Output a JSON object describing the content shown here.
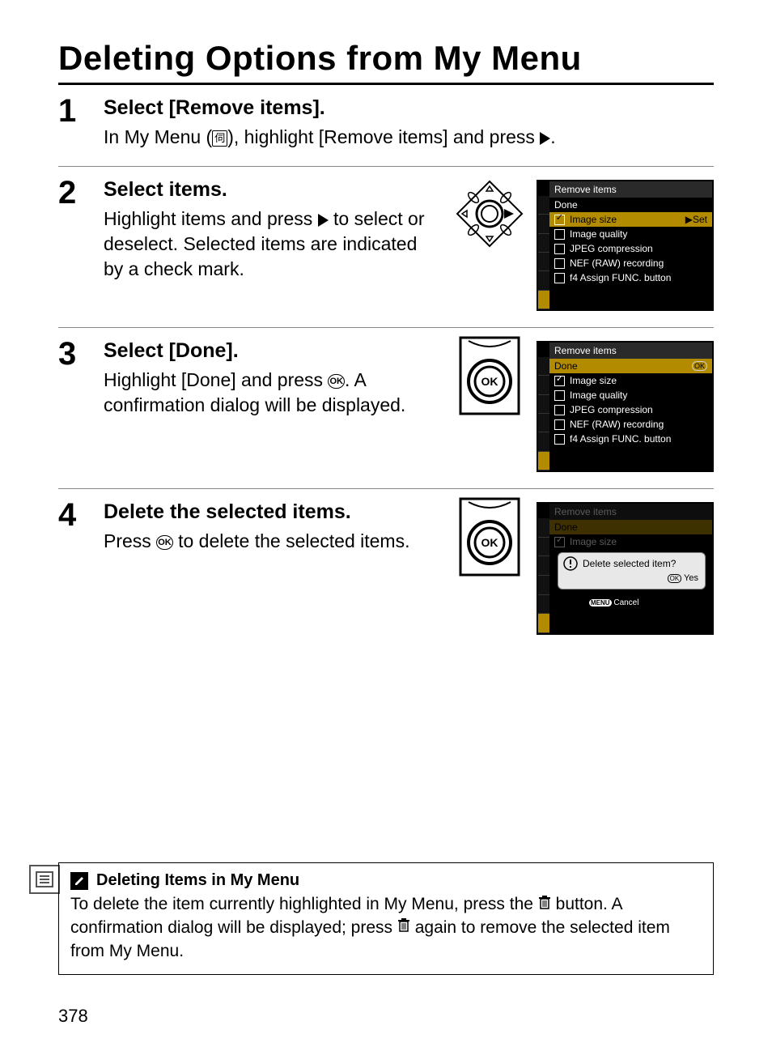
{
  "page_number": "378",
  "section_title": "Deleting Options from My Menu",
  "steps": [
    {
      "num": "1",
      "head": "Select [Remove items].",
      "text_pre": "In My Menu (",
      "text_post": "), highlight [Remove items] and press ",
      "text_end": "."
    },
    {
      "num": "2",
      "head": "Select items.",
      "text_pre": "Highlight items and press ",
      "text_post": " to select or deselect.  Selected items are indicated by a check mark."
    },
    {
      "num": "3",
      "head": "Select [Done].",
      "text_pre": "Highlight [Done] and press ",
      "text_post": ".  A confirmation dialog will be displayed."
    },
    {
      "num": "4",
      "head": "Delete the selected items.",
      "text_pre": "Press ",
      "text_post": " to delete the selected items."
    }
  ],
  "screen2": {
    "title": "Remove items",
    "rows": [
      {
        "label": "Done",
        "checked": null
      },
      {
        "label": "Image size",
        "checked": true,
        "hl": true,
        "right": "▶Set"
      },
      {
        "label": "Image quality",
        "checked": false
      },
      {
        "label": "JPEG compression",
        "checked": false
      },
      {
        "label": "NEF (RAW) recording",
        "checked": false
      },
      {
        "label": "f4 Assign FUNC. button",
        "checked": false
      }
    ]
  },
  "screen3": {
    "title": "Remove items",
    "rows": [
      {
        "label": "Done",
        "checked": null,
        "hl": true,
        "right": "OK"
      },
      {
        "label": "Image size",
        "checked": true
      },
      {
        "label": "Image quality",
        "checked": false
      },
      {
        "label": "JPEG compression",
        "checked": false
      },
      {
        "label": "NEF (RAW) recording",
        "checked": false
      },
      {
        "label": "f4 Assign FUNC. button",
        "checked": false
      }
    ]
  },
  "screen4": {
    "title": "Remove items",
    "dim_rows": [
      "Done",
      "Image size"
    ],
    "dialog_msg": "Delete selected item?",
    "dialog_yes": "OK Yes",
    "dialog_cancel": "MENU Cancel"
  },
  "footnote": {
    "head": "Deleting Items in My Menu",
    "text_a": "To delete the item currently highlighted in My Menu, press the ",
    "text_b": " button.  A confirmation dialog will be displayed; press ",
    "text_c": " again to remove the selected item from My Menu."
  },
  "glyphs": {
    "ok": "OK",
    "mymenu": "伺"
  }
}
